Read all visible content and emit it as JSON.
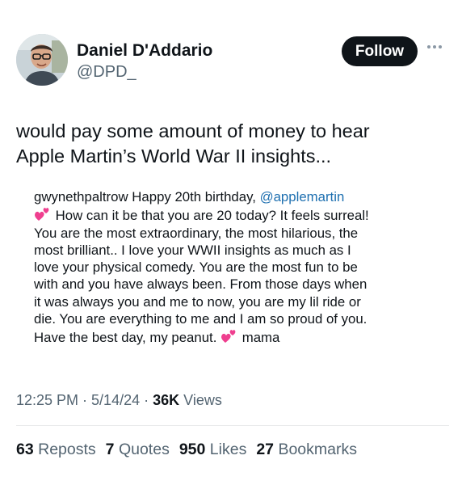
{
  "author": {
    "display_name": "Daniel D'Addario",
    "handle": "@DPD_",
    "avatar_icon": "avatar-photo"
  },
  "follow_button": {
    "label": "Follow",
    "color": "#0f1419"
  },
  "more_icon": "more-horizontal-icon",
  "tweet_text_lines": [
    "would pay some amount of money to hear",
    "Apple Martin’s World War II insights..."
  ],
  "quoted_post": {
    "username": "gwynethpaltrow",
    "first_line_text": "Happy 20th birthday, ",
    "mention": "@applemartin",
    "second_line_text": "How can it be that you are 20 today? It feels surreal!",
    "lines": [
      "You are the most extraordinary, the most hilarious, the",
      "most brilliant.. I love your WWII insights as much as I",
      "love your physical comedy. You are the most fun to be",
      "with and you have always been. From those days when",
      "it was always you and me to now, you are my lil ride or",
      "die. You are everything to me and I am so proud of you."
    ],
    "last_line_text": "Have the best day, my peanut.",
    "sign_off": "mama",
    "emoji": "two-hearts-icon",
    "mention_color": "#1d6fb0"
  },
  "meta": {
    "time": "12:25 PM",
    "sep1": " · ",
    "date": "5/14/24",
    "sep2": " · ",
    "views_count": "36K",
    "views_label": " Views"
  },
  "stats": {
    "reposts_count": "63",
    "reposts_label": "Reposts",
    "quotes_count": "7",
    "quotes_label": "Quotes",
    "likes_count": "950",
    "likes_label": "Likes",
    "bookmarks_count": "27",
    "bookmarks_label": "Bookmarks"
  }
}
